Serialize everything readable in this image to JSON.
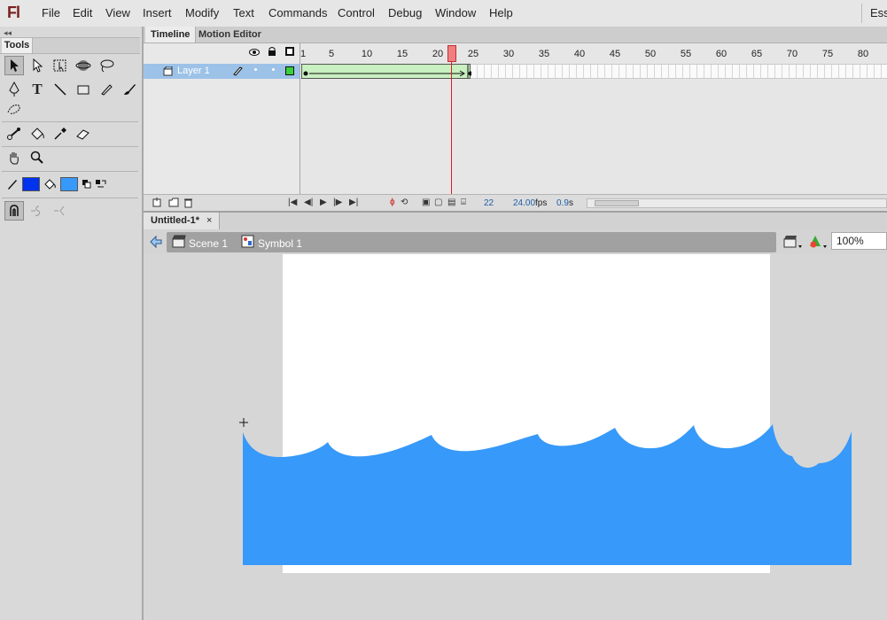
{
  "app": {
    "logo": "Fl",
    "workspace": "Esse"
  },
  "menu": [
    "File",
    "Edit",
    "View",
    "Insert",
    "Modify",
    "Text",
    "Commands",
    "Control",
    "Debug",
    "Window",
    "Help"
  ],
  "tools": {
    "panel_title": "Tools",
    "stroke_color": "#222222",
    "fill_color": "#3799f9",
    "stroke_swatch": "#0033ee"
  },
  "timeline": {
    "tabs": [
      "Timeline",
      "Motion Editor"
    ],
    "layer_name": "Layer 1",
    "ruler": [
      "1",
      "5",
      "10",
      "15",
      "20",
      "25",
      "30",
      "35",
      "40",
      "45",
      "50",
      "55",
      "60",
      "65",
      "70",
      "75",
      "80"
    ],
    "current_frame": "22",
    "fps": "24.00",
    "fps_unit": "fps",
    "time": "0.9",
    "time_unit": "s"
  },
  "document": {
    "tab_label": "Untitled-1*",
    "close": "×"
  },
  "editbar": {
    "scene": "Scene 1",
    "symbol": "Symbol 1",
    "zoom": "100%"
  },
  "colors": {
    "water": "#3799f9",
    "stage": "#ffffff",
    "pasteboard": "#d6d6d6",
    "tween": "#c8f0c0",
    "playhead": "#d02020"
  }
}
